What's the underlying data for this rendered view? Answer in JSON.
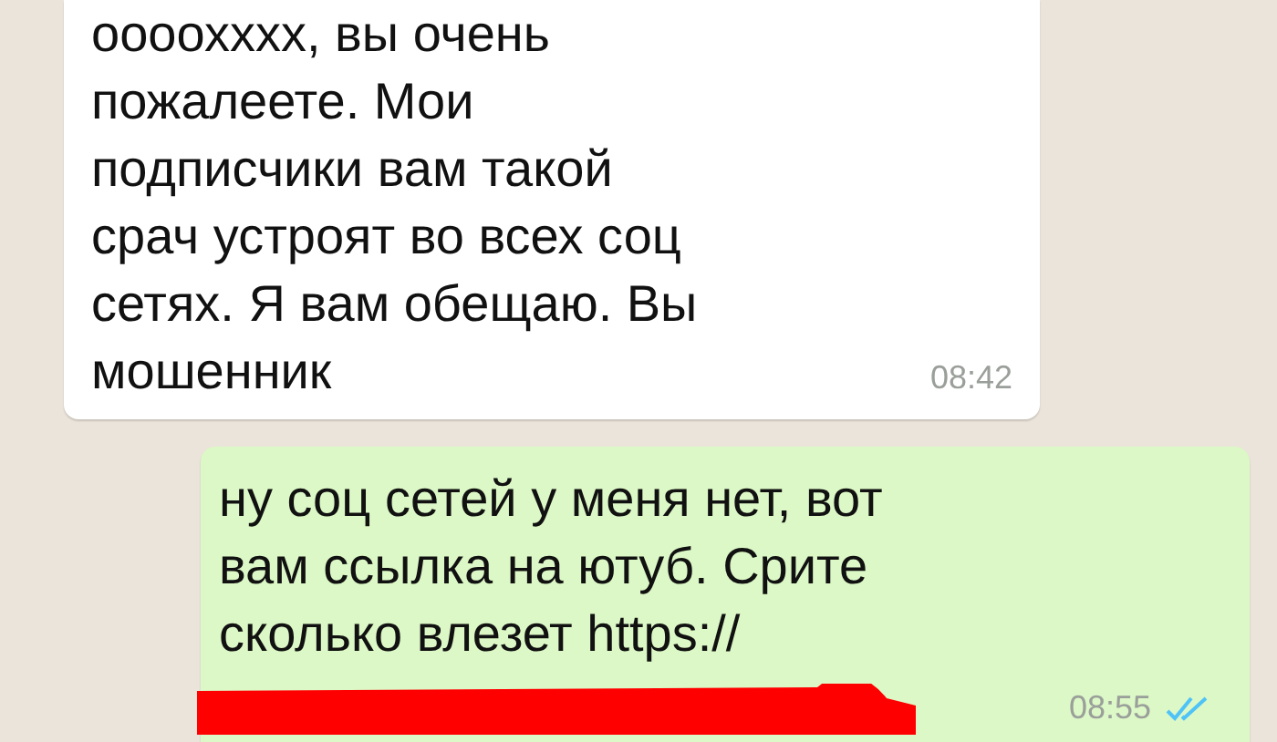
{
  "messages": [
    {
      "kind": "incoming",
      "lines": [
        "оооохххх, вы очень",
        "пожалеете. Мои",
        "подписчики вам такой",
        "срач устроят во всех соц",
        "сетях. Я вам обещаю. Вы",
        "мошенник"
      ],
      "time": "08:42"
    },
    {
      "kind": "outgoing",
      "lines": [
        "ну соц сетей у меня нет, вот",
        "вам ссылка на ютуб. Срите",
        "сколько влезет https://"
      ],
      "time": "08:55",
      "read": true,
      "redacted": true
    }
  ]
}
